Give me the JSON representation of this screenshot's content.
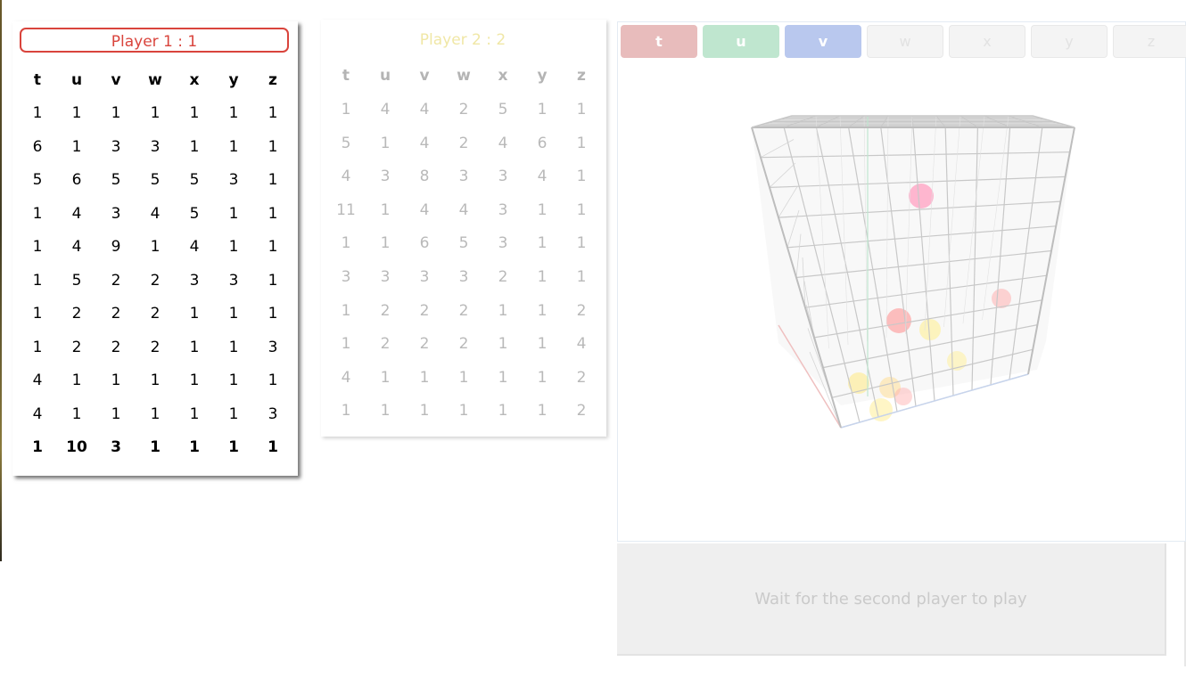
{
  "player1": {
    "title": "Player 1 : 1",
    "headers": [
      "t",
      "u",
      "v",
      "w",
      "x",
      "y",
      "z"
    ],
    "rows": [
      [
        "1",
        "1",
        "1",
        "1",
        "1",
        "1",
        "1"
      ],
      [
        "6",
        "1",
        "3",
        "3",
        "1",
        "1",
        "1"
      ],
      [
        "5",
        "6",
        "5",
        "5",
        "5",
        "3",
        "1"
      ],
      [
        "1",
        "4",
        "3",
        "4",
        "5",
        "1",
        "1"
      ],
      [
        "1",
        "4",
        "9",
        "1",
        "4",
        "1",
        "1"
      ],
      [
        "1",
        "5",
        "2",
        "2",
        "3",
        "3",
        "1"
      ],
      [
        "1",
        "2",
        "2",
        "2",
        "1",
        "1",
        "1"
      ],
      [
        "1",
        "2",
        "2",
        "2",
        "1",
        "1",
        "3"
      ],
      [
        "4",
        "1",
        "1",
        "1",
        "1",
        "1",
        "1"
      ],
      [
        "4",
        "1",
        "1",
        "1",
        "1",
        "1",
        "3"
      ],
      [
        "1",
        "10",
        "3",
        "1",
        "1",
        "1",
        "1"
      ]
    ]
  },
  "player2": {
    "title": "Player 2 : 2",
    "headers": [
      "t",
      "u",
      "v",
      "w",
      "x",
      "y",
      "z"
    ],
    "rows": [
      [
        "1",
        "4",
        "4",
        "2",
        "5",
        "1",
        "1"
      ],
      [
        "5",
        "1",
        "4",
        "2",
        "4",
        "6",
        "1"
      ],
      [
        "4",
        "3",
        "8",
        "3",
        "3",
        "4",
        "1"
      ],
      [
        "11",
        "1",
        "4",
        "4",
        "3",
        "1",
        "1"
      ],
      [
        "1",
        "1",
        "6",
        "5",
        "3",
        "1",
        "1"
      ],
      [
        "3",
        "3",
        "3",
        "3",
        "2",
        "1",
        "1"
      ],
      [
        "1",
        "2",
        "2",
        "2",
        "1",
        "1",
        "2"
      ],
      [
        "1",
        "2",
        "2",
        "2",
        "1",
        "1",
        "4"
      ],
      [
        "4",
        "1",
        "1",
        "1",
        "1",
        "1",
        "2"
      ],
      [
        "1",
        "1",
        "1",
        "1",
        "1",
        "1",
        "2"
      ]
    ]
  },
  "axis_buttons": [
    {
      "label": "t",
      "color": "#e8bcbc",
      "active": true
    },
    {
      "label": "u",
      "color": "#bfe6cf",
      "active": true
    },
    {
      "label": "v",
      "color": "#b9c8ee",
      "active": true
    },
    {
      "label": "w",
      "active": false
    },
    {
      "label": "x",
      "active": false
    },
    {
      "label": "y",
      "active": false
    },
    {
      "label": "z",
      "active": false
    }
  ],
  "status_message": "Wait for the second player to play",
  "colors": {
    "player1_accent": "#d9443c",
    "player2_accent": "#f0e7a6",
    "cube_grid": "#c8c8c8"
  }
}
